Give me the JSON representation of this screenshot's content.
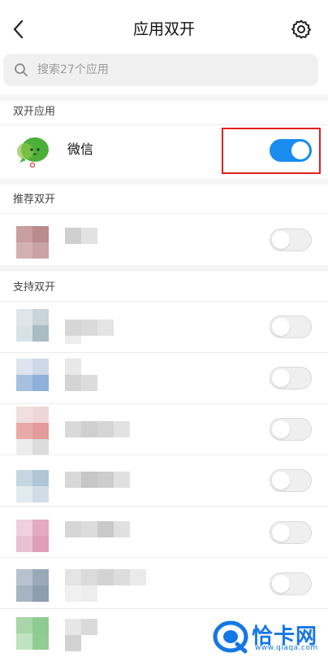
{
  "header": {
    "title": "应用双开",
    "back_icon": "chevron-left-icon",
    "settings_icon": "gear-icon"
  },
  "search": {
    "placeholder": "搜索27个应用",
    "value": ""
  },
  "sections": {
    "dual": "双开应用",
    "recommended": "推荐双开",
    "supported": "支持双开"
  },
  "dual_apps": [
    {
      "name": "微信",
      "enabled": true
    }
  ],
  "recommended_apps": [
    {
      "name": "",
      "enabled": false
    }
  ],
  "supported_apps": [
    {
      "name": "",
      "enabled": false
    },
    {
      "name": "",
      "enabled": false
    },
    {
      "name": "",
      "enabled": false
    },
    {
      "name": "",
      "enabled": false
    },
    {
      "name": "",
      "enabled": false
    },
    {
      "name": "",
      "enabled": false
    },
    {
      "name": "",
      "enabled": false
    }
  ],
  "colors": {
    "accent": "#1a8cf0",
    "highlight": "#e02020"
  },
  "watermark": {
    "text": "恰卡网",
    "sub": "www.qiaqa.com"
  }
}
